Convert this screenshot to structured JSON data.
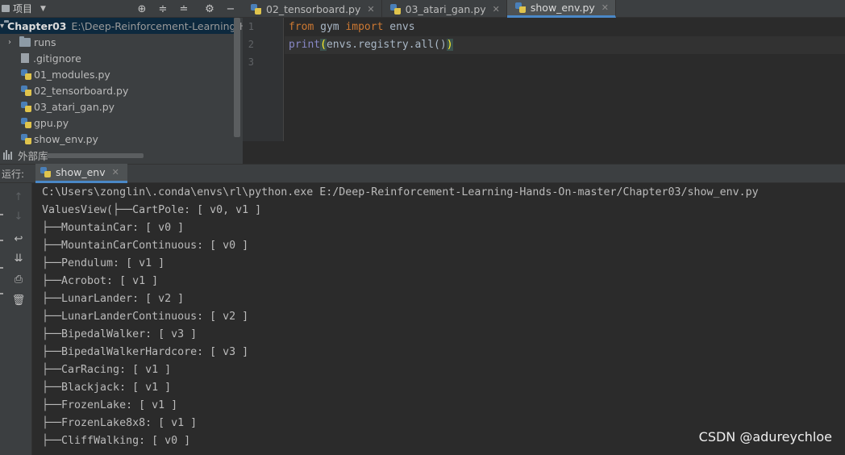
{
  "project_toolbar": {
    "label": "项目"
  },
  "editor_tabs": [
    {
      "label": "02_tensorboard.py",
      "active": false
    },
    {
      "label": "03_atari_gan.py",
      "active": false
    },
    {
      "label": "show_env.py",
      "active": true
    }
  ],
  "project_tree": {
    "root": {
      "name": "Chapter03",
      "path": "E:\\Deep-Reinforcement-Learning-Ha"
    },
    "items": [
      {
        "name": "runs",
        "type": "folder"
      },
      {
        "name": ".gitignore",
        "type": "file"
      },
      {
        "name": "01_modules.py",
        "type": "python"
      },
      {
        "name": "02_tensorboard.py",
        "type": "python"
      },
      {
        "name": "03_atari_gan.py",
        "type": "python"
      },
      {
        "name": "gpu.py",
        "type": "python"
      },
      {
        "name": "show_env.py",
        "type": "python"
      }
    ],
    "external_libraries": "外部库"
  },
  "editor": {
    "line_numbers": [
      "1",
      "2",
      "3"
    ],
    "line1": {
      "kw_from": "from",
      "module": " gym ",
      "kw_import": "import",
      "name": " envs"
    },
    "line2": {
      "builtin": "print",
      "open": "(",
      "args": "envs.registry.all()",
      "close": ")"
    }
  },
  "run": {
    "title": "运行:",
    "tab_label": "show_env",
    "console": [
      "C:\\Users\\zonglin\\.conda\\envs\\rl\\python.exe E:/Deep-Reinforcement-Learning-Hands-On-master/Chapter03/show_env.py",
      "ValuesView(├──CartPole: [ v0, v1 ]",
      "├──MountainCar: [ v0 ]",
      "├──MountainCarContinuous: [ v0 ]",
      "├──Pendulum: [ v1 ]",
      "├──Acrobot: [ v1 ]",
      "├──LunarLander: [ v2 ]",
      "├──LunarLanderContinuous: [ v2 ]",
      "├──BipedalWalker: [ v3 ]",
      "├──BipedalWalkerHardcore: [ v3 ]",
      "├──CarRacing: [ v1 ]",
      "├──Blackjack: [ v1 ]",
      "├──FrozenLake: [ v1 ]",
      "├──FrozenLake8x8: [ v1 ]",
      "├──CliffWalking: [ v0 ]"
    ]
  },
  "watermark": "CSDN @adureychloe",
  "colors": {
    "keyword": "#cc7832",
    "builtin": "#8888c6",
    "selection": "#0d293e",
    "tab_underline": "#4a88c7"
  }
}
